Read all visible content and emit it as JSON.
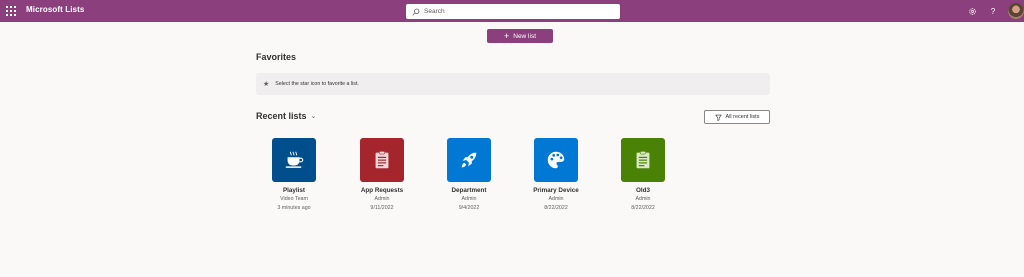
{
  "header": {
    "app_title": "Microsoft Lists",
    "search_placeholder": "Search",
    "bar_color": "#8b3f7d",
    "icons": [
      "waffle-icon",
      "search-icon",
      "settings-icon",
      "help-icon",
      "avatar"
    ]
  },
  "actions": {
    "new_list_label": "New list",
    "new_list_icon": "plus-icon"
  },
  "favorites": {
    "title": "Favorites",
    "hint": "Select the star icon to favorite a list."
  },
  "recent": {
    "title": "Recent lists",
    "all_recent_label": "All recent lists",
    "items": [
      {
        "name": "Playlist",
        "owner": "Video Team",
        "date": "3 minutes ago",
        "icon": "coffee-cup-icon",
        "color": "#004e8c"
      },
      {
        "name": "App Requests",
        "owner": "Admin",
        "date": "9/11/2022",
        "icon": "clipboard-icon",
        "color": "#a4262c"
      },
      {
        "name": "Department",
        "owner": "Admin",
        "date": "9/4/2022",
        "icon": "rocket-icon",
        "color": "#0078d4"
      },
      {
        "name": "Primary Device",
        "owner": "Admin",
        "date": "8/22/2022",
        "icon": "palette-icon",
        "color": "#0078d4"
      },
      {
        "name": "Old3",
        "owner": "Admin",
        "date": "8/22/2022",
        "icon": "clipboard-icon",
        "color": "#498205"
      }
    ]
  }
}
